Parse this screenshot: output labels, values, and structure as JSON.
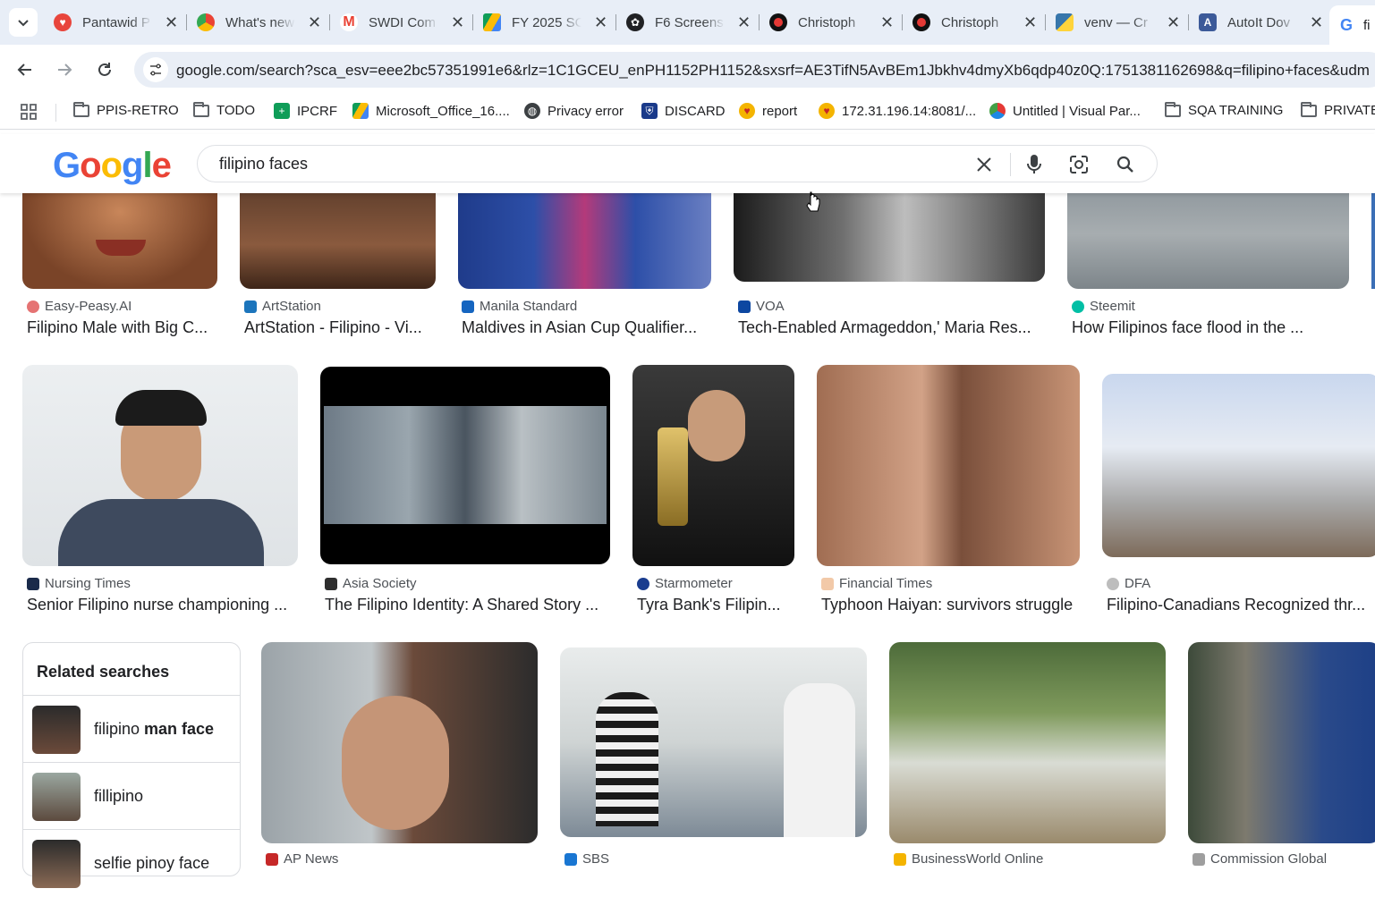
{
  "browser": {
    "tabs": [
      {
        "title": "Pantawid P",
        "favicon": "heart-icon",
        "color": "#e8453c"
      },
      {
        "title": "What's new",
        "favicon": "chrome-icon",
        "color": "#4285f4"
      },
      {
        "title": "SWDI Com",
        "favicon": "gmail-icon",
        "color": "#ea4335"
      },
      {
        "title": "FY 2025 SC",
        "favicon": "drive-icon",
        "color": "#0f9d58"
      },
      {
        "title": "F6 Screens",
        "favicon": "openai-icon",
        "color": "#202124"
      },
      {
        "title": "Christoph",
        "favicon": "record-icon",
        "color": "#c5221f"
      },
      {
        "title": "Christoph",
        "favicon": "record-icon",
        "color": "#c5221f"
      },
      {
        "title": "venv — Cr",
        "favicon": "python-icon",
        "color": "#3776ab"
      },
      {
        "title": "AutoIt Dov",
        "favicon": "autoit-icon",
        "color": "#3c5a99"
      }
    ],
    "active_tab": {
      "title": "fi",
      "favicon": "google-icon"
    },
    "url": "google.com/search?sca_esv=eee2bc57351991e6&rlz=1C1GCEU_enPH1152PH1152&sxsrf=AE3TifN5AvBEm1Jbkhv4dmyXb6qdp40z0Q:1751381162698&q=filipino+faces&udm",
    "bookmarks": [
      {
        "label": "PPIS-RETRO",
        "icon": "folder-icon"
      },
      {
        "label": "TODO",
        "icon": "folder-icon"
      },
      {
        "label": "IPCRF",
        "icon": "sheets-icon"
      },
      {
        "label": "Microsoft_Office_16....",
        "icon": "drive-icon"
      },
      {
        "label": "Privacy error",
        "icon": "globe-icon"
      },
      {
        "label": "DISCARD",
        "icon": "shield-icon"
      },
      {
        "label": "report",
        "icon": "heart-icon"
      },
      {
        "label": "172.31.196.14:8081/...",
        "icon": "heart-icon"
      },
      {
        "label": "Untitled | Visual Par...",
        "icon": "paradigm-icon"
      },
      {
        "label": "SQA TRAINING",
        "icon": "folder-icon"
      },
      {
        "label": "PRIVATE",
        "icon": "folder-icon"
      }
    ]
  },
  "google": {
    "query": "filipino faces"
  },
  "results": {
    "row1": [
      {
        "source": "Easy-Peasy.AI",
        "caption": "Filipino Male with Big C..."
      },
      {
        "source": "ArtStation",
        "caption": "ArtStation - Filipino - Vi..."
      },
      {
        "source": "Manila Standard",
        "caption": "Maldives in Asian Cup Qualifier..."
      },
      {
        "source": "VOA",
        "caption": "Tech-Enabled Armageddon,' Maria Res..."
      },
      {
        "source": "Steemit",
        "caption": "How Filipinos face flood in the ..."
      }
    ],
    "row2": [
      {
        "source": "Nursing Times",
        "caption": "Senior Filipino nurse championing ..."
      },
      {
        "source": "Asia Society",
        "caption": "The Filipino Identity: A Shared Story ..."
      },
      {
        "source": "Starmometer",
        "caption": "Tyra Bank's Filipin..."
      },
      {
        "source": "Financial Times",
        "caption": "Typhoon Haiyan: survivors struggle"
      },
      {
        "source": "DFA",
        "caption": "Filipino-Canadians Recognized thr..."
      }
    ],
    "row3_sources": [
      "AP News",
      "SBS",
      "BusinessWorld Online",
      "Commission Global"
    ]
  },
  "related": {
    "heading": "Related searches",
    "items": [
      {
        "plain": "filipino ",
        "bold": "man face"
      },
      {
        "plain": "fillipino",
        "bold": ""
      },
      {
        "plain": "selfie pinoy face",
        "bold": ""
      }
    ]
  }
}
